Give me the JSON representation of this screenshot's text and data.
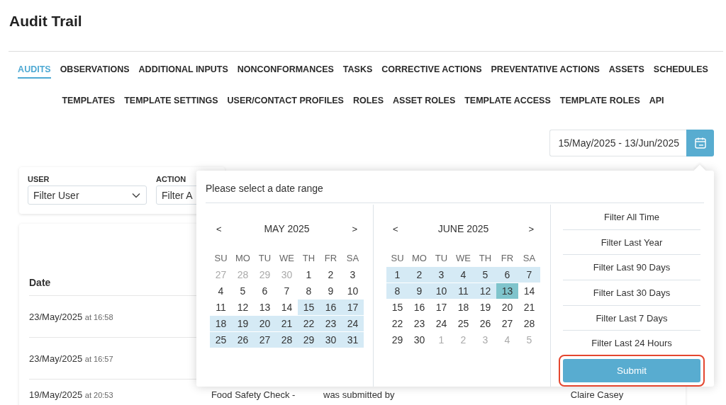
{
  "page": {
    "title": "Audit Trail"
  },
  "tabs": [
    {
      "label": "AUDITS",
      "selected": true
    },
    {
      "label": "OBSERVATIONS",
      "selected": false
    },
    {
      "label": "ADDITIONAL INPUTS",
      "selected": false
    },
    {
      "label": "NONCONFORMANCES",
      "selected": false
    },
    {
      "label": "TASKS",
      "selected": false
    },
    {
      "label": "CORRECTIVE ACTIONS",
      "selected": false
    },
    {
      "label": "PREVENTATIVE ACTIONS",
      "selected": false
    },
    {
      "label": "ASSETS",
      "selected": false
    },
    {
      "label": "SCHEDULES",
      "selected": false
    },
    {
      "label": "TEMPLATES",
      "selected": false
    },
    {
      "label": "TEMPLATE SETTINGS",
      "selected": false
    },
    {
      "label": "USER/CONTACT PROFILES",
      "selected": false
    },
    {
      "label": "ROLES",
      "selected": false
    },
    {
      "label": "ASSET ROLES",
      "selected": false
    },
    {
      "label": "TEMPLATE ACCESS",
      "selected": false
    },
    {
      "label": "TEMPLATE ROLES",
      "selected": false
    },
    {
      "label": "API",
      "selected": false
    }
  ],
  "date_range": {
    "value": "15/May/2025 - 13/Jun/2025"
  },
  "filters": [
    {
      "label": "USER",
      "placeholder": "Filter User"
    },
    {
      "label": "ACTION",
      "placeholder": "Filter A"
    }
  ],
  "table": {
    "columns": [
      {
        "heading": "Date"
      }
    ],
    "rows": [
      {
        "date": "23/May/2025",
        "time": "at 16:58"
      },
      {
        "date": "23/May/2025",
        "time": "at 16:57"
      },
      {
        "date": "19/May/2025",
        "time": "at 20:53",
        "column_2": "Food Safety Check -",
        "column_3": "was submitted by",
        "column_4": "Claire Casey"
      }
    ]
  },
  "date_picker": {
    "prompt": "Please select a date range",
    "months": [
      {
        "title": "MAY 2025",
        "prev": "<",
        "next": ">",
        "weekdays": [
          "SU",
          "MO",
          "TU",
          "WE",
          "TH",
          "FR",
          "SA"
        ],
        "weeks": [
          [
            {
              "day": "27",
              "outside": true,
              "in_range": false,
              "selected": false
            },
            {
              "day": "28",
              "outside": true,
              "in_range": false,
              "selected": false
            },
            {
              "day": "29",
              "outside": true,
              "in_range": false,
              "selected": false
            },
            {
              "day": "30",
              "outside": true,
              "in_range": false,
              "selected": false
            },
            {
              "day": "1",
              "outside": false,
              "in_range": false,
              "selected": false
            },
            {
              "day": "2",
              "outside": false,
              "in_range": false,
              "selected": false
            },
            {
              "day": "3",
              "outside": false,
              "in_range": false,
              "selected": false
            }
          ],
          [
            {
              "day": "4",
              "outside": false,
              "in_range": false,
              "selected": false
            },
            {
              "day": "5",
              "outside": false,
              "in_range": false,
              "selected": false
            },
            {
              "day": "6",
              "outside": false,
              "in_range": false,
              "selected": false
            },
            {
              "day": "7",
              "outside": false,
              "in_range": false,
              "selected": false
            },
            {
              "day": "8",
              "outside": false,
              "in_range": false,
              "selected": false
            },
            {
              "day": "9",
              "outside": false,
              "in_range": false,
              "selected": false
            },
            {
              "day": "10",
              "outside": false,
              "in_range": false,
              "selected": false
            }
          ],
          [
            {
              "day": "11",
              "outside": false,
              "in_range": false,
              "selected": false
            },
            {
              "day": "12",
              "outside": false,
              "in_range": false,
              "selected": false
            },
            {
              "day": "13",
              "outside": false,
              "in_range": false,
              "selected": false
            },
            {
              "day": "14",
              "outside": false,
              "in_range": false,
              "selected": false
            },
            {
              "day": "15",
              "outside": false,
              "in_range": true,
              "selected": false
            },
            {
              "day": "16",
              "outside": false,
              "in_range": true,
              "selected": false
            },
            {
              "day": "17",
              "outside": false,
              "in_range": true,
              "selected": false
            }
          ],
          [
            {
              "day": "18",
              "outside": false,
              "in_range": true,
              "selected": false
            },
            {
              "day": "19",
              "outside": false,
              "in_range": true,
              "selected": false
            },
            {
              "day": "20",
              "outside": false,
              "in_range": true,
              "selected": false
            },
            {
              "day": "21",
              "outside": false,
              "in_range": true,
              "selected": false
            },
            {
              "day": "22",
              "outside": false,
              "in_range": true,
              "selected": false
            },
            {
              "day": "23",
              "outside": false,
              "in_range": true,
              "selected": false
            },
            {
              "day": "24",
              "outside": false,
              "in_range": true,
              "selected": false
            }
          ],
          [
            {
              "day": "25",
              "outside": false,
              "in_range": true,
              "selected": false
            },
            {
              "day": "26",
              "outside": false,
              "in_range": true,
              "selected": false
            },
            {
              "day": "27",
              "outside": false,
              "in_range": true,
              "selected": false
            },
            {
              "day": "28",
              "outside": false,
              "in_range": true,
              "selected": false
            },
            {
              "day": "29",
              "outside": false,
              "in_range": true,
              "selected": false
            },
            {
              "day": "30",
              "outside": false,
              "in_range": true,
              "selected": false
            },
            {
              "day": "31",
              "outside": false,
              "in_range": true,
              "selected": false
            }
          ]
        ]
      },
      {
        "title": "JUNE 2025",
        "prev": "<",
        "next": ">",
        "weekdays": [
          "SU",
          "MO",
          "TU",
          "WE",
          "TH",
          "FR",
          "SA"
        ],
        "weeks": [
          [
            {
              "day": "1",
              "outside": false,
              "in_range": true,
              "selected": false
            },
            {
              "day": "2",
              "outside": false,
              "in_range": true,
              "selected": false
            },
            {
              "day": "3",
              "outside": false,
              "in_range": true,
              "selected": false
            },
            {
              "day": "4",
              "outside": false,
              "in_range": true,
              "selected": false
            },
            {
              "day": "5",
              "outside": false,
              "in_range": true,
              "selected": false
            },
            {
              "day": "6",
              "outside": false,
              "in_range": true,
              "selected": false
            },
            {
              "day": "7",
              "outside": false,
              "in_range": true,
              "selected": false
            }
          ],
          [
            {
              "day": "8",
              "outside": false,
              "in_range": true,
              "selected": false
            },
            {
              "day": "9",
              "outside": false,
              "in_range": true,
              "selected": false
            },
            {
              "day": "10",
              "outside": false,
              "in_range": true,
              "selected": false
            },
            {
              "day": "11",
              "outside": false,
              "in_range": true,
              "selected": false
            },
            {
              "day": "12",
              "outside": false,
              "in_range": true,
              "selected": false
            },
            {
              "day": "13",
              "outside": false,
              "in_range": true,
              "selected": true
            },
            {
              "day": "14",
              "outside": false,
              "in_range": false,
              "selected": false
            }
          ],
          [
            {
              "day": "15",
              "outside": false,
              "in_range": false,
              "selected": false
            },
            {
              "day": "16",
              "outside": false,
              "in_range": false,
              "selected": false
            },
            {
              "day": "17",
              "outside": false,
              "in_range": false,
              "selected": false
            },
            {
              "day": "18",
              "outside": false,
              "in_range": false,
              "selected": false
            },
            {
              "day": "19",
              "outside": false,
              "in_range": false,
              "selected": false
            },
            {
              "day": "20",
              "outside": false,
              "in_range": false,
              "selected": false
            },
            {
              "day": "21",
              "outside": false,
              "in_range": false,
              "selected": false
            }
          ],
          [
            {
              "day": "22",
              "outside": false,
              "in_range": false,
              "selected": false
            },
            {
              "day": "23",
              "outside": false,
              "in_range": false,
              "selected": false
            },
            {
              "day": "24",
              "outside": false,
              "in_range": false,
              "selected": false
            },
            {
              "day": "25",
              "outside": false,
              "in_range": false,
              "selected": false
            },
            {
              "day": "26",
              "outside": false,
              "in_range": false,
              "selected": false
            },
            {
              "day": "27",
              "outside": false,
              "in_range": false,
              "selected": false
            },
            {
              "day": "28",
              "outside": false,
              "in_range": false,
              "selected": false
            }
          ],
          [
            {
              "day": "29",
              "outside": false,
              "in_range": false,
              "selected": false
            },
            {
              "day": "30",
              "outside": false,
              "in_range": false,
              "selected": false
            },
            {
              "day": "1",
              "outside": true,
              "in_range": false,
              "selected": false
            },
            {
              "day": "2",
              "outside": true,
              "in_range": false,
              "selected": false
            },
            {
              "day": "3",
              "outside": true,
              "in_range": false,
              "selected": false
            },
            {
              "day": "4",
              "outside": true,
              "in_range": false,
              "selected": false
            },
            {
              "day": "5",
              "outside": true,
              "in_range": false,
              "selected": false
            }
          ]
        ]
      }
    ],
    "presets": [
      "Filter All Time",
      "Filter Last Year",
      "Filter Last 90 Days",
      "Filter Last 30 Days",
      "Filter Last 7 Days",
      "Filter Last 24 Hours"
    ],
    "submit": {
      "label": "Submit",
      "highlighted": true
    }
  }
}
